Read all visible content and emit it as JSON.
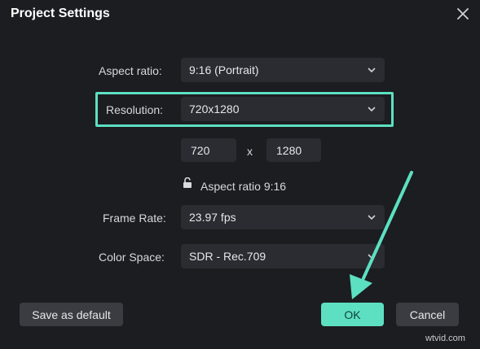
{
  "dialog": {
    "title": "Project Settings"
  },
  "fields": {
    "aspect_ratio": {
      "label": "Aspect ratio:",
      "value": "9:16 (Portrait)"
    },
    "resolution": {
      "label": "Resolution:",
      "value": "720x1280"
    },
    "width": "720",
    "separator": "x",
    "height": "1280",
    "lock_text": "Aspect ratio 9:16",
    "frame_rate": {
      "label": "Frame Rate:",
      "value": "23.97 fps"
    },
    "color_space": {
      "label": "Color Space:",
      "value": "SDR - Rec.709"
    }
  },
  "buttons": {
    "save_default": "Save as default",
    "ok": "OK",
    "cancel": "Cancel"
  },
  "watermark": "wtvid.com",
  "colors": {
    "accent": "#5ce0c1",
    "background": "#1c1d21",
    "control": "#2a2c31"
  },
  "icons": {
    "close": "close-icon",
    "chevron": "chevron-down-icon",
    "lock": "unlocked-padlock-icon",
    "annotation": "arrow-annotation"
  }
}
